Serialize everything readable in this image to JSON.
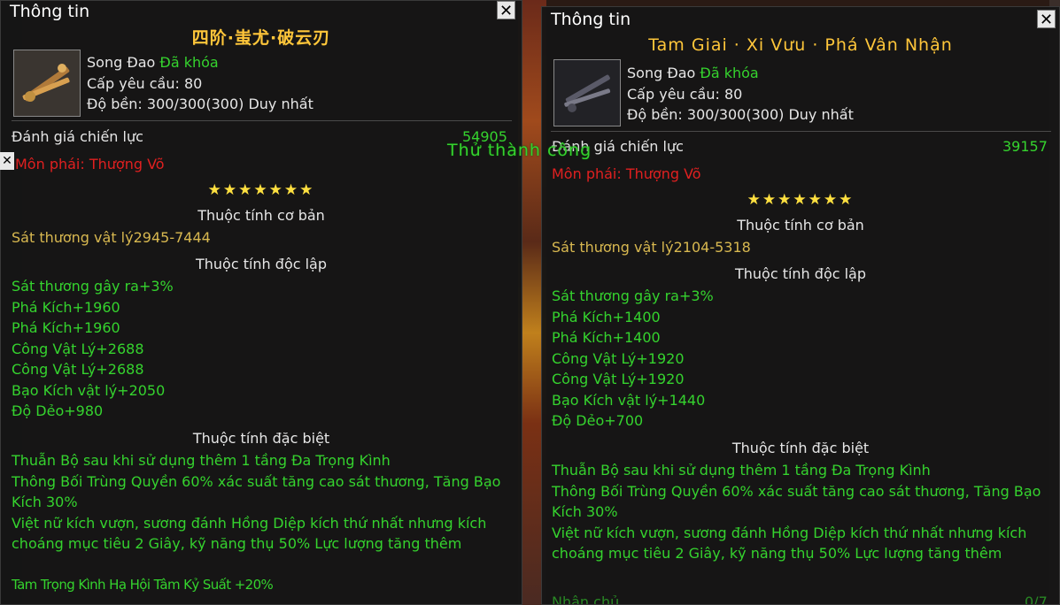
{
  "panels": [
    {
      "title": "Thông tin",
      "item_name": "四阶·蚩尤·破云刃",
      "weapon_type": "Song Đao",
      "lock_status": "Đã khóa",
      "level_req": "Cấp yêu cầu: 80",
      "durability": "Độ bền: 300/300(300)  Duy nhất",
      "rating_label": "Đánh giá chiến lực",
      "rating_value": "54905",
      "school": "Môn phái: Thượng Võ",
      "stars": "★★★★★★★",
      "basic_header": "Thuộc tính cơ bản",
      "basic_attr": "Sát thương vật lý2945-7444",
      "independent_header": "Thuộc tính độc lập",
      "independent_attrs": [
        "Sát thương gây ra+3%",
        "Phá Kích+1960",
        "Phá Kích+1960",
        "Công Vật Lý+2688",
        "Công Vật Lý+2688",
        "Bạo Kích vật lý+2050",
        "Độ Dẻo+980"
      ],
      "special_header": "Thuộc tính đặc biệt",
      "special_attrs": [
        "Thuẫn Bộ sau khi sử dụng thêm 1 tầng Đa Trọng Kình",
        "Thông Bối Trùng Quyền 60% xác suất tăng cao sát thương, Tăng Bạo Kích 30%",
        "Việt nữ kích vượn, sương đánh Hồng Diệp kích thứ nhất nhưng kích choáng mục tiêu 2 Giây, kỹ năng thụ 50% Lực lượng tăng thêm",
        "Tam Trọng Kình Hạ Hội Tâm Kỷ Suất +20%"
      ]
    },
    {
      "title": "Thông tin",
      "item_name": "Tam Giai · Xi Vưu · Phá Vân Nhận",
      "weapon_type": "Song Đao",
      "lock_status": "Đã khóa",
      "level_req": "Cấp yêu cầu: 80",
      "durability": "Độ bền: 300/300(300)  Duy nhất",
      "rating_label": "Đánh giá chiến lực",
      "rating_value": "39157",
      "school": "Môn phái: Thượng Võ",
      "stars": "★★★★★★★",
      "basic_header": "Thuộc tính cơ bản",
      "basic_attr": "Sát thương vật lý2104-5318",
      "independent_header": "Thuộc tính độc lập",
      "independent_attrs": [
        "Sát thương gây ra+3%",
        "Phá Kích+1400",
        "Phá Kích+1400",
        "Công Vật Lý+1920",
        "Công Vật Lý+1920",
        "Bạo Kích vật lý+1440",
        "Độ Dẻo+700"
      ],
      "special_header": "Thuộc tính đặc biệt",
      "special_attrs": [
        "Thuẫn Bộ sau khi sử dụng thêm 1 tầng Đa Trọng Kình",
        "Thông Bối Trùng Quyền 60% xác suất tăng cao sát thương, Tăng Bạo Kích 30%",
        "Việt nữ kích vượn, sương đánh Hồng Diệp kích thứ nhất nhưng kích choáng mục tiêu 2 Giây, kỹ năng thụ 50% Lực lượng tăng thêm"
      ],
      "owner_label": "Nhận chủ",
      "owner_value": "0/7"
    }
  ],
  "toast": "Thử thành công",
  "close_icon": "✕",
  "colors": {
    "item_name": "#ffc63a",
    "green_text": "#35d32e",
    "school_red": "#e02020",
    "basic_gold": "#d8b850",
    "panel_bg": "#161616"
  }
}
